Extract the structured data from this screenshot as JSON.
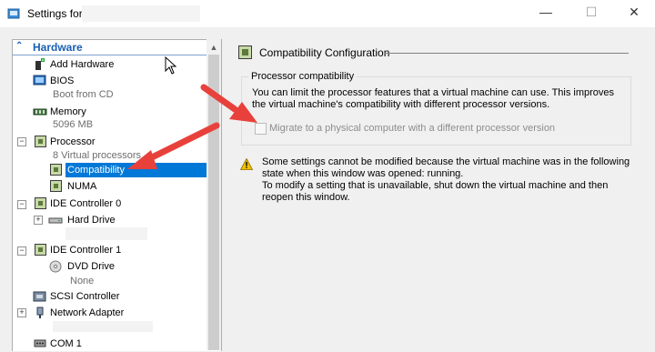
{
  "window": {
    "title": "Settings for",
    "minimize_glyph": "—",
    "maximize_glyph": "☐",
    "close_glyph": "✕"
  },
  "tree": {
    "header": "Hardware",
    "items": {
      "add_hardware": {
        "label": "Add Hardware"
      },
      "bios": {
        "label": "BIOS",
        "sub": "Boot from CD"
      },
      "memory": {
        "label": "Memory",
        "sub": "5096 MB"
      },
      "processor": {
        "label": "Processor",
        "sub": "8 Virtual processors"
      },
      "compatibility": {
        "label": "Compatibility"
      },
      "numa": {
        "label": "NUMA"
      },
      "ide0": {
        "label": "IDE Controller 0"
      },
      "hard_drive": {
        "label": "Hard Drive"
      },
      "ide1": {
        "label": "IDE Controller 1"
      },
      "dvd_drive": {
        "label": "DVD Drive",
        "sub": "None"
      },
      "scsi": {
        "label": "SCSI Controller"
      },
      "network": {
        "label": "Network Adapter"
      },
      "com1": {
        "label": "COM 1"
      }
    }
  },
  "detail": {
    "section_title": "Compatibility Configuration",
    "group_title": "Processor compatibility",
    "group_desc": "You can limit the processor features that a virtual machine can use. This improves the virtual machine's compatibility with different processor versions.",
    "checkbox_label": "Migrate to a physical computer with a different processor version",
    "checkbox_checked": false,
    "warning_line1": "Some settings cannot be modified because the virtual machine was in the following state when this window was opened: running.",
    "warning_line2": "To modify a setting that is unavailable, shut down the virtual machine and then reopen this window."
  },
  "colors": {
    "selection": "#0078d7",
    "header_text": "#1a5fb4",
    "annotation_arrow": "#e8413b"
  }
}
